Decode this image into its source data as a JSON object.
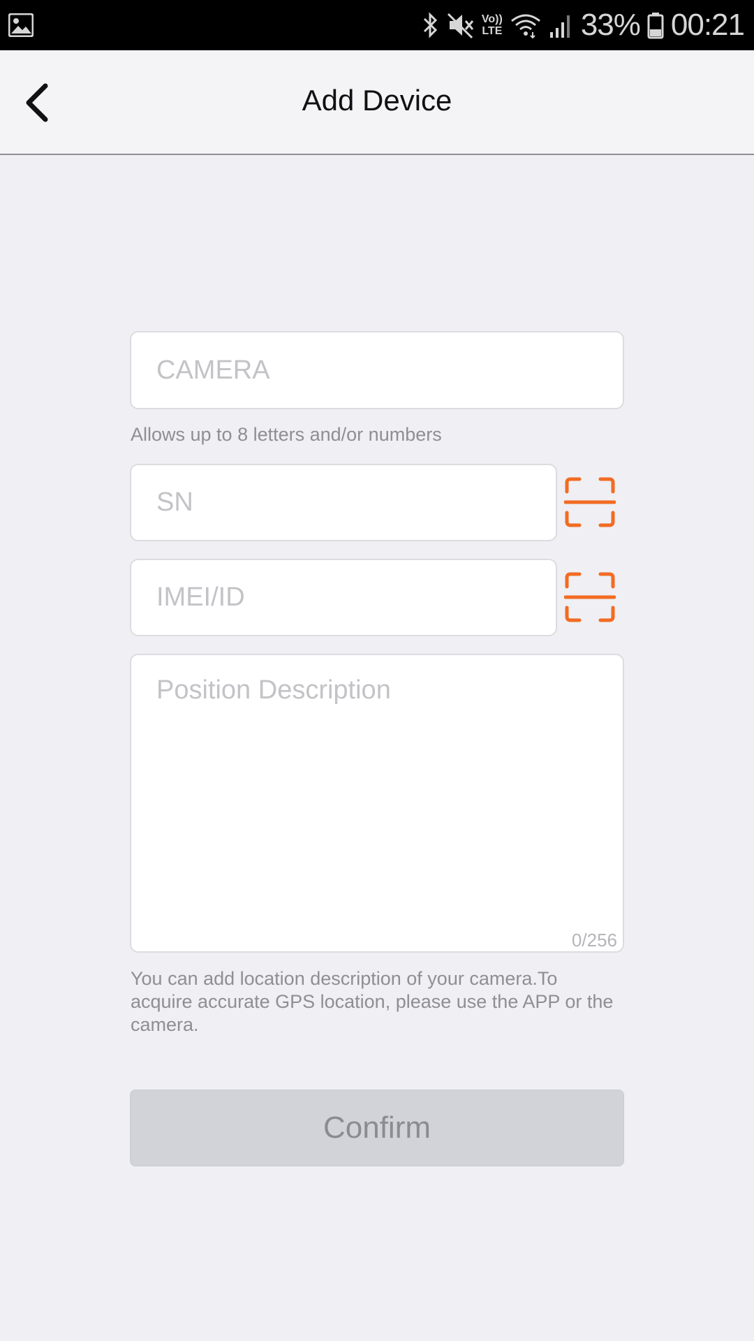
{
  "status_bar": {
    "battery": "33%",
    "time": "00:21",
    "volte_line1": "Vo))",
    "volte_line2": "LTE",
    "icons": [
      "gallery-icon",
      "bluetooth-icon",
      "mute-icon",
      "volte-icon",
      "wifi-icon",
      "signal-icon",
      "battery-icon"
    ]
  },
  "header": {
    "title": "Add Device",
    "back_icon": "chevron-left-icon"
  },
  "form": {
    "camera_placeholder": "CAMERA",
    "camera_hint": "Allows up to 8 letters and/or numbers",
    "sn_placeholder": "SN",
    "imei_placeholder": "IMEI/ID",
    "position_placeholder": "Position Description",
    "position_counter": "0/256",
    "position_hint": "You can add location description of your camera.To acquire accurate GPS location, please use the APP or the camera.",
    "scan_icon": "scan-icon",
    "accent_color": "#f26b21"
  },
  "confirm": {
    "label": "Confirm"
  }
}
